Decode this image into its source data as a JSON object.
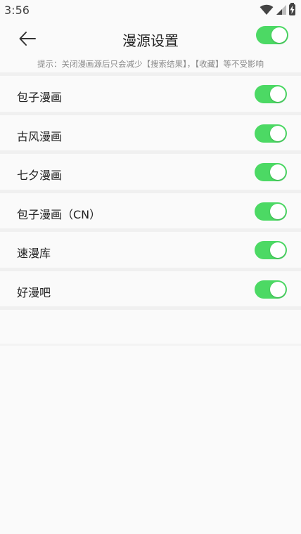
{
  "status_bar": {
    "time": "3:56"
  },
  "header": {
    "title": "漫源设置",
    "master_toggle_on": true
  },
  "hint": "提示：关闭漫画源后只会减少【搜索结果】，【收藏】等不受影响",
  "sources": [
    {
      "name": "包子漫画",
      "enabled": true
    },
    {
      "name": "古风漫画",
      "enabled": true
    },
    {
      "name": "七夕漫画",
      "enabled": true
    },
    {
      "name": "包子漫画（CN）",
      "enabled": true
    },
    {
      "name": "速漫库",
      "enabled": true
    },
    {
      "name": "好漫吧",
      "enabled": true
    }
  ],
  "colors": {
    "toggle_on": "#4cd964",
    "background": "#fafafa",
    "divider": "#f0f0f0",
    "hint_text": "#8a8a8a"
  }
}
